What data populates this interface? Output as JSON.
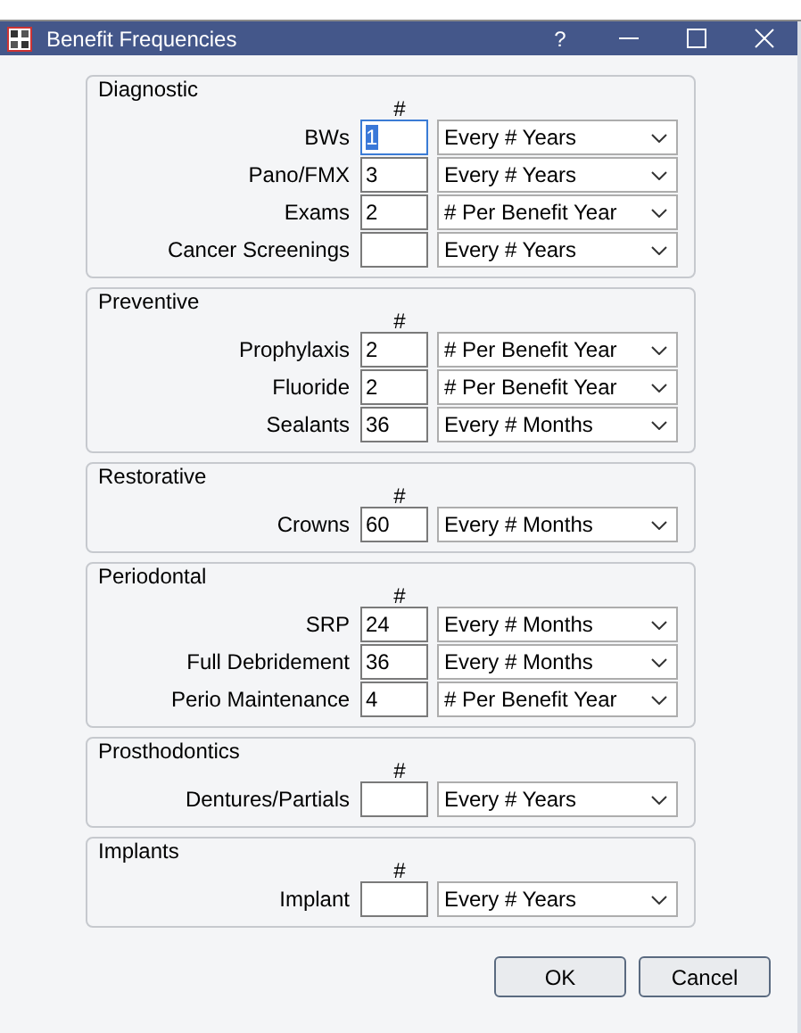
{
  "window": {
    "title": "Benefit Frequencies",
    "help": "?"
  },
  "column_header": "#",
  "groups": [
    {
      "title": "Diagnostic",
      "rows": [
        {
          "label": "BWs",
          "value": "1",
          "selected": true,
          "frequency": "Every # Years"
        },
        {
          "label": "Pano/FMX",
          "value": "3",
          "selected": false,
          "frequency": "Every # Years"
        },
        {
          "label": "Exams",
          "value": "2",
          "selected": false,
          "frequency": "# Per Benefit Year"
        },
        {
          "label": "Cancer Screenings",
          "value": "",
          "selected": false,
          "frequency": "Every # Years"
        }
      ]
    },
    {
      "title": "Preventive",
      "rows": [
        {
          "label": "Prophylaxis",
          "value": "2",
          "selected": false,
          "frequency": "# Per Benefit Year"
        },
        {
          "label": "Fluoride",
          "value": "2",
          "selected": false,
          "frequency": "# Per Benefit Year"
        },
        {
          "label": "Sealants",
          "value": "36",
          "selected": false,
          "frequency": "Every # Months"
        }
      ]
    },
    {
      "title": "Restorative",
      "rows": [
        {
          "label": "Crowns",
          "value": "60",
          "selected": false,
          "frequency": "Every # Months"
        }
      ]
    },
    {
      "title": "Periodontal",
      "rows": [
        {
          "label": "SRP",
          "value": "24",
          "selected": false,
          "frequency": "Every # Months"
        },
        {
          "label": "Full Debridement",
          "value": "36",
          "selected": false,
          "frequency": "Every # Months"
        },
        {
          "label": "Perio Maintenance",
          "value": "4",
          "selected": false,
          "frequency": "# Per Benefit Year"
        }
      ]
    },
    {
      "title": "Prosthodontics",
      "rows": [
        {
          "label": "Dentures/Partials",
          "value": "",
          "selected": false,
          "frequency": "Every # Years"
        }
      ]
    },
    {
      "title": "Implants",
      "rows": [
        {
          "label": "Implant",
          "value": "",
          "selected": false,
          "frequency": "Every # Years"
        }
      ]
    }
  ],
  "buttons": [
    "OK",
    "Cancel"
  ]
}
